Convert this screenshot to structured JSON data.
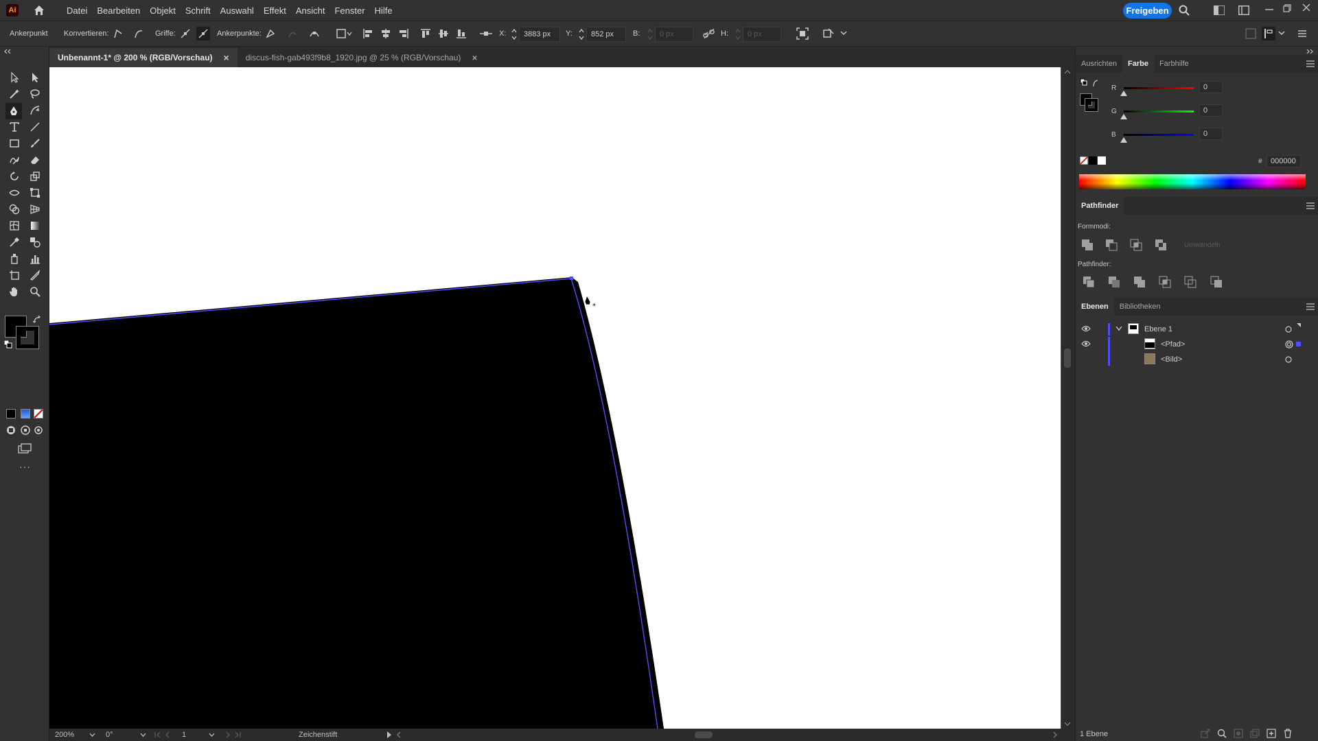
{
  "app": {
    "logo": "Ai"
  },
  "menu": [
    "Datei",
    "Bearbeiten",
    "Objekt",
    "Schrift",
    "Auswahl",
    "Effekt",
    "Ansicht",
    "Fenster",
    "Hilfe"
  ],
  "share_button": "Freigeben",
  "control": {
    "mode": "Ankerpunkt",
    "convert": "Konvertieren:",
    "handles": "Griffe:",
    "anchors": "Ankerpunkte:",
    "x_label": "X:",
    "x_value": "3883 px",
    "y_label": "Y:",
    "y_value": "852 px",
    "w_label": "B:",
    "w_value": "0 px",
    "h_label": "H:",
    "h_value": "0 px"
  },
  "tabs": [
    {
      "label": "Unbenannt-1* @ 200 % (RGB/Vorschau)",
      "close": "×"
    },
    {
      "label": "discus-fish-gab493f9b8_1920.jpg @ 25 % (RGB/Vorschau)",
      "close": "×"
    }
  ],
  "status": {
    "zoom": "200%",
    "rotation": "0°",
    "artboard": "1",
    "tool": "Zeichenstift",
    "layers_count": "1 Ebene"
  },
  "color_panel": {
    "tabs": [
      "Ausrichten",
      "Farbe",
      "Farbhilfe"
    ],
    "active_tab": "Farbe",
    "r_label": "R",
    "r_value": "0",
    "g_label": "G",
    "g_value": "0",
    "b_label": "B",
    "b_value": "0",
    "hex_label": "#",
    "hex_value": "000000",
    "colors": {
      "r": "#e03030",
      "g": "#30c030",
      "b": "#3050e0"
    }
  },
  "pathfinder": {
    "title": "Pathfinder",
    "shape_modes": "Formmodi:",
    "expand": "Umwandeln",
    "pathfinders": "Pathfinder:"
  },
  "layers_panel": {
    "tabs": [
      "Ebenen",
      "Bibliotheken"
    ],
    "active_tab": "Ebenen",
    "layer": "Ebene 1",
    "items": [
      "<Pfad>",
      "<Bild>"
    ]
  },
  "colors": {
    "accent": "#1473e6",
    "selection": "#4f4fff",
    "artboard": "#ffffff",
    "shape_fill": "#000000"
  }
}
